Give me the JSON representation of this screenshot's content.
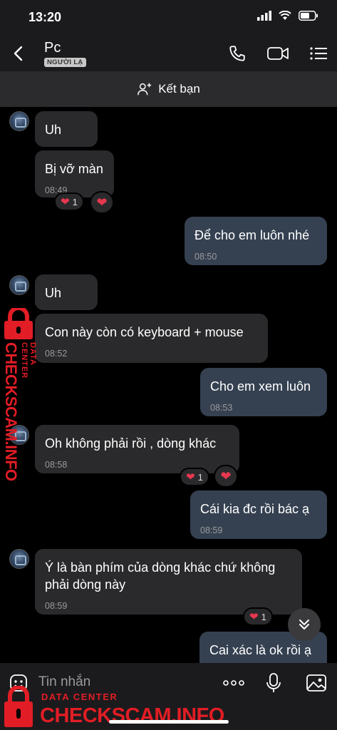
{
  "status_bar": {
    "time": "13:20"
  },
  "header": {
    "name": "Pc",
    "badge": "NGƯỜI LẠ"
  },
  "add_friend": {
    "label": "Kết bạn"
  },
  "messages": [
    {
      "text": "Uh",
      "time": ""
    },
    {
      "text": "Bị vỡ màn",
      "time": "08:49",
      "reaction_count": "1"
    },
    {
      "text": "Để cho em luôn nhé",
      "time": "08:50"
    },
    {
      "text": "Uh",
      "time": ""
    },
    {
      "text": "Con này còn có keyboard + mouse",
      "time": "08:52"
    },
    {
      "text": "Cho em xem luôn",
      "time": "08:53"
    },
    {
      "text": "Oh không phải rồi , dòng khác",
      "time": "08:58",
      "reaction_count": "1"
    },
    {
      "text": "Cái kia đc rồi bác ạ",
      "time": "08:59"
    },
    {
      "text": "Ý là bàn phím của dòng khác chứ không phải dòng này",
      "time": "08:59",
      "reaction_count": "1"
    },
    {
      "text": "Cai xác là ok rồi ạ",
      "time": ""
    }
  ],
  "input": {
    "placeholder": "Tin nhắn"
  },
  "watermark": {
    "line1": "DATA CENTER",
    "line2": "CHECKSCAM.INFO"
  },
  "colors": {
    "incoming": "#2a2a2c",
    "outgoing": "#354151",
    "heart": "#e8384f",
    "watermark": "#e21d25"
  }
}
